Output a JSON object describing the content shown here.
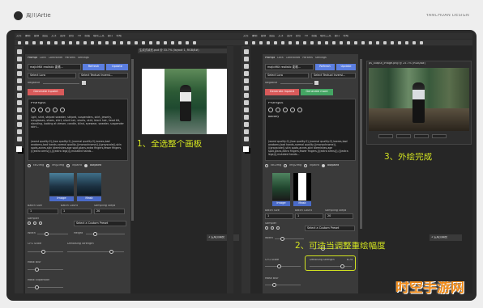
{
  "header": {
    "author": "周川Artie",
    "studio": "YANCHUAN DESIGN"
  },
  "menubar": [
    "文件",
    "编辑",
    "图像",
    "图层",
    "文字",
    "选择",
    "滤镜",
    "3D",
    "视图",
    "增效工具",
    "窗口",
    "帮助"
  ],
  "doc_tabs": {
    "left": "生成式填充.psd @ 33.7% (layout 1, RGB/8#)",
    "middle": "生成式填充_图层 @ 25.7% (layout 1 ext_artboard, RGB/8#)",
    "right_win": "ps_output_image.png @ 25.7% (RGB/8#)"
  },
  "plugin": {
    "tabs": [
      "Prompt",
      "Lora",
      "Controlnet",
      "Params",
      "Settings"
    ],
    "model": "majicMIX realistic 麦橘...",
    "refresh": "Refresh",
    "update": "Update",
    "lora_select": "Select Lora",
    "textual_select": "Select Textual Inversi...",
    "negative_label": "Negative",
    "gen_left": "Generate Inpaint",
    "gen_right_red": "Generate Inpaint",
    "gen_right_green": "Generate more",
    "prompts_title": "Prompts",
    "prompt_left": "1girl, shirt, striped sweater, striped, suspenders, skirt, jewelry, sunglasses, shoes, shirt, short hair, shorts, skirt, black hair, head tilt, standing, looking at viewer, candle, blind, eyewear, sweater, suspender skirt...",
    "prompt_right": "balcony",
    "negative_text": "(worst quality:2),(low quality:2),(normal quality:2),lowres,bad anatomy,bad hands,normal quality,((monochrome)),((grayscale)),skin spots,acnes,skin blemishes,age spot,glans,extra fingers,fewer fingers,(((extra arms))),(((extra legs))),mutated hands...",
    "mode_tabs": [
      "txt2img",
      "img2img",
      "inpaint",
      "outpaint"
    ],
    "image_label": "Image",
    "mask_label": "Mask",
    "field_labels": [
      "Batch Size",
      "Batch Count",
      "Sampling Steps"
    ],
    "field_values": [
      "1",
      "1",
      "20"
    ],
    "sampler_label": "Sampler",
    "sampler_value": "Select a Custom Preset",
    "width_label": "Width",
    "height_label": "Height",
    "cfg_label": "CFG Scale",
    "denoise_label": "Denoising Strength",
    "denoise_value": "0.75",
    "mask_content_label": "Mask Content",
    "mask_blur_label": "Mask Blur",
    "mask_expansion_label": "Mask Expansion",
    "steps_label": "Steps",
    "seed_label": "Seed"
  },
  "bottom_bars": {
    "left": "1 生成式填充",
    "right": "1 生成式填充"
  },
  "annotations": {
    "step1": "1、全选整个画板",
    "step2": "2、可适当调整重绘幅度",
    "step3": "3、外绘完成"
  },
  "watermark": "时空手游网",
  "colors": {
    "page_bg": "#eeeeee",
    "frame": "#2a2a2a",
    "ps_bg": "#262626",
    "panel": "#3a3a3a",
    "accent_blue": "#5b7ee0",
    "generate_red": "#d85a5a",
    "generate_green": "#44a563",
    "callout": "#d2e320",
    "watermark": "#f08c1a"
  }
}
